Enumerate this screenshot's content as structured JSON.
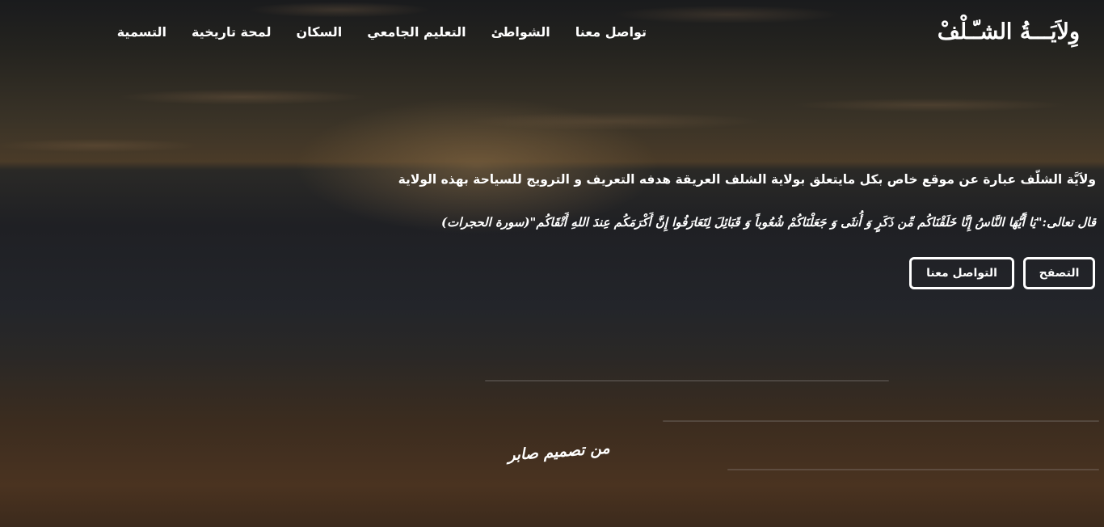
{
  "site": {
    "logo": "وِلاَيَـــةُ الشـّـلْفْ"
  },
  "nav": {
    "items": [
      {
        "label": "التسمية"
      },
      {
        "label": "لمحة تاريخية"
      },
      {
        "label": "السكان"
      },
      {
        "label": "التعليم الجامعي"
      },
      {
        "label": "الشواطئ"
      },
      {
        "label": "تواصل معنا"
      }
    ]
  },
  "hero": {
    "intro": "ولاَيَّة الشلّف عبارة عن موقع خاص بكل مايتعلق بولاية الشلف العريقة هدفه التعريف و الترويج للسياحة بهذه الولاية",
    "verse": "قال تعالى:\"يَا أَيُّهَا النَّاسُ إِنَّا خَلَقْنَاكُم مِّن ذَكَرٍ وَ أُنثَى وَ جَعَلْنَاكُمْ شُعُوباً وَ قَبَائِلَ لِتَعَارَفُوا إِنَّ أَكْرَمَكُم عِندَ اللهِ أَتْقَاكُم\"(سورة الحجرات)",
    "buttons": {
      "browse": "التصفح",
      "contact": "التواصل معنا"
    },
    "credit": "من تصميم صابر"
  }
}
